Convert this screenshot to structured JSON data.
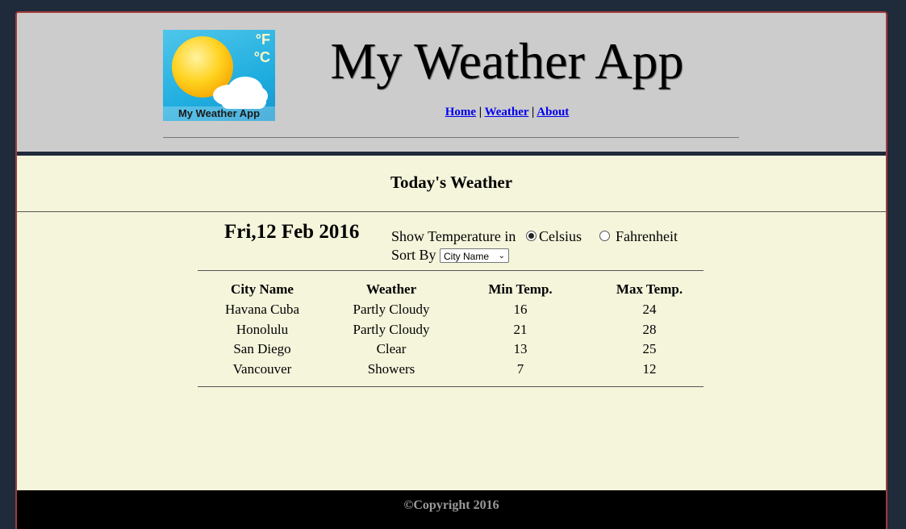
{
  "header": {
    "title": "My Weather App",
    "logo": {
      "caption": "My Weather App",
      "deg_f": "°F",
      "deg_c": "°C"
    },
    "nav": [
      {
        "label": "Home"
      },
      {
        "label": "Weather"
      },
      {
        "label": "About"
      }
    ],
    "nav_separator": "|"
  },
  "main": {
    "subtitle": "Today's Weather",
    "date": "Fri,12 Feb 2016",
    "temperature": {
      "label": "Show Temperature in",
      "options": [
        "Celsius",
        "Fahrenheit"
      ],
      "selected": "Celsius"
    },
    "sort": {
      "label": "Sort By",
      "selected": "City Name"
    },
    "table": {
      "columns": [
        "City Name",
        "Weather",
        "Min Temp.",
        "Max Temp."
      ],
      "rows": [
        [
          "Havana Cuba",
          "Partly Cloudy",
          "16",
          "24"
        ],
        [
          "Honolulu",
          "Partly Cloudy",
          "21",
          "28"
        ],
        [
          "San Diego",
          "Clear",
          "13",
          "25"
        ],
        [
          "Vancouver",
          "Showers",
          "7",
          "12"
        ]
      ]
    }
  },
  "footer": {
    "copyright": "©Copyright 2016"
  },
  "colors": {
    "page_bg": "#1f2a3a",
    "header_bg": "#cccccc",
    "content_bg": "#f5f5dc",
    "frame_border": "#a33a3a",
    "link": "#0000ee",
    "footer_bg": "#000000"
  }
}
